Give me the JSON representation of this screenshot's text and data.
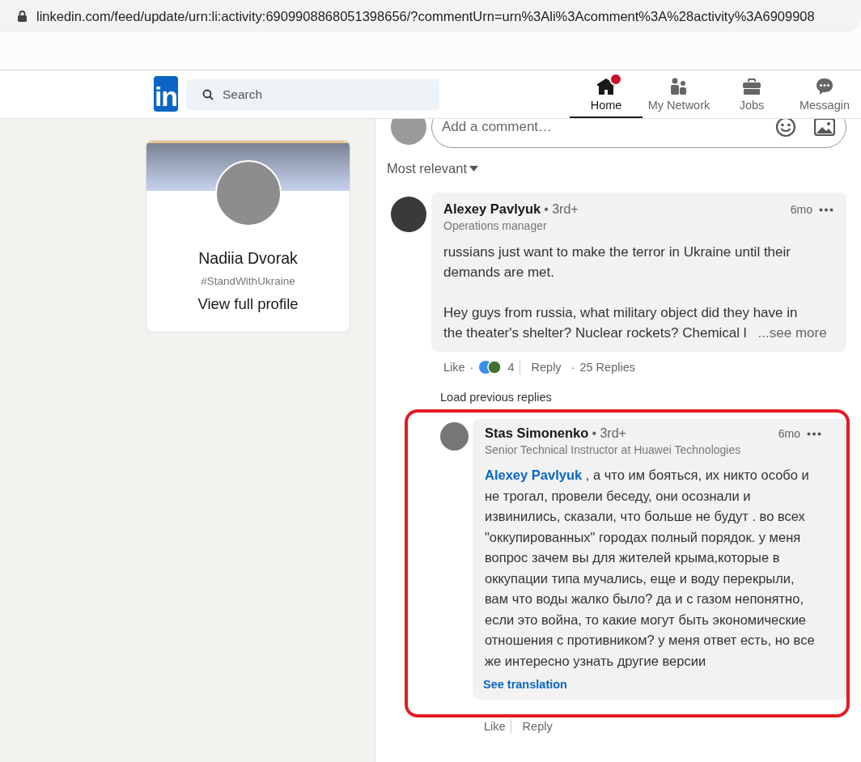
{
  "browser": {
    "url": "linkedin.com/feed/update/urn:li:activity:6909908868051398656/?commentUrn=urn%3Ali%3Acomment%3A%28activity%3A6909908"
  },
  "nav": {
    "logo": "in",
    "search": {
      "placeholder": "Search"
    },
    "items": [
      {
        "label": "Home",
        "kind": "home",
        "selected": true,
        "notification": true
      },
      {
        "label": "My Network",
        "kind": "network",
        "selected": false,
        "notification": false
      },
      {
        "label": "Jobs",
        "kind": "jobs",
        "selected": false,
        "notification": false
      },
      {
        "label": "Messagin",
        "kind": "messaging",
        "selected": false,
        "notification": false
      }
    ]
  },
  "profile_card": {
    "name": "Nadiia Dvorak",
    "headline": "#StandWithUkraine",
    "link": "View full profile"
  },
  "composer": {
    "placeholder": "Add a comment…"
  },
  "sort": {
    "label": "Most relevant"
  },
  "comment": {
    "author": "Alexey Pavlyuk",
    "degree": "• 3rd+",
    "headline": "Operations manager",
    "time": "6mo",
    "paragraphs": [
      "russians just want to make the terror in Ukraine until their demands are met."
    ],
    "truncated_lines": [
      "Hey guys from russia, what military object did they have in",
      "the theater's shelter? Nuclear rockets? Chemical l"
    ],
    "see_more": "...see more",
    "like": "Like",
    "separator": "·",
    "reaction_count": "4",
    "reply": "Reply",
    "separator_2": "·",
    "replies": "25 Replies"
  },
  "load_previous": "Load previous replies",
  "reply": {
    "highlighted": true,
    "author": "Stas Simonenko",
    "degree": "• 3rd+",
    "headline": "Senior Technical Instructor at Huawei Technologies",
    "time": "6mo",
    "mention": "Alexey Pavlyuk",
    "text": " , а что им бояться, их никто особо и не трогал, провели беседу, они осознали и извинились, сказали, что больше не будут . во всех \"оккупированных\" городах полный порядок. у меня вопрос зачем вы для жителей крыма,которые в оккупации типа мучались, еще и воду перекрыли, вам что воды жалко было? да и с газом непонятно, если это война, то какие могут быть экономические отношения с противником? у меня ответ есть, но все же интересно узнать другие версии",
    "see_translation": "See translation",
    "like": "Like",
    "reply": "Reply"
  }
}
